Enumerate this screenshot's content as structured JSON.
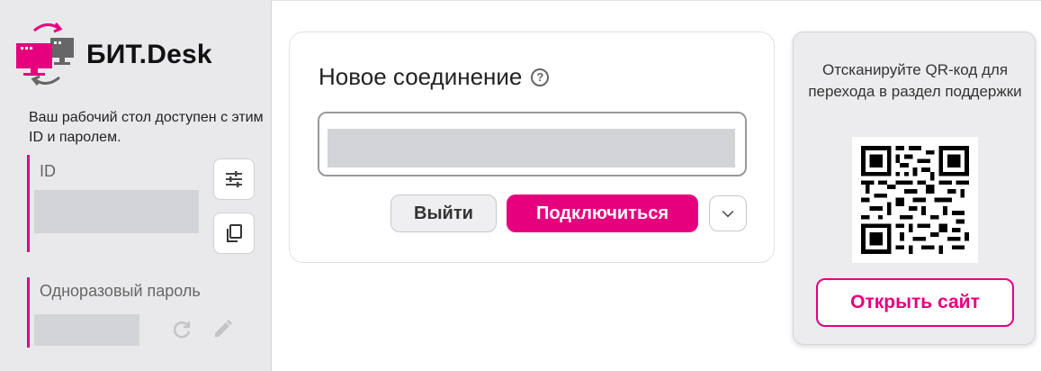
{
  "brand": {
    "name": "БИТ.Desk"
  },
  "sidebar": {
    "description": "Ваш рабочий стол доступен с этим ID и паролем.",
    "id_label": "ID",
    "password_label": "Одноразовый пароль"
  },
  "connection": {
    "title": "Новое соединение",
    "exit_label": "Выйти",
    "connect_label": "Подключиться"
  },
  "support": {
    "scan_text": "Отсканируйте QR-код для перехода в раздел поддержки",
    "open_site_label": "Открыть сайт"
  },
  "colors": {
    "accent": "#e6007e",
    "sidebar_bg": "#e9e9ec",
    "placeholder": "#d3d4d7"
  },
  "icons": [
    "logo-monitors-icon",
    "settings-sliders-icon",
    "copy-icon",
    "refresh-icon",
    "edit-pencil-icon",
    "help-icon",
    "chevron-down-icon",
    "qr-code-icon"
  ]
}
